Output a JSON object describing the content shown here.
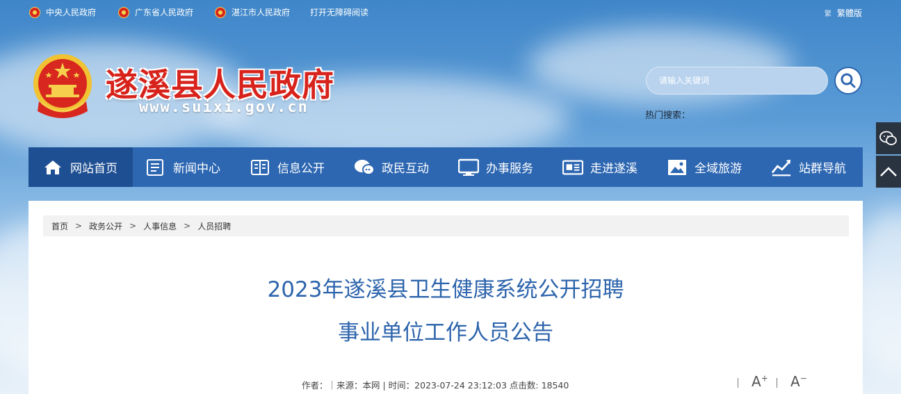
{
  "topbar": {
    "links": [
      {
        "label": "中央人民政府",
        "icon": "emblem-icon"
      },
      {
        "label": "广东省人民政府",
        "icon": "emblem-icon"
      },
      {
        "label": "湛江市人民政府",
        "icon": "emblem-icon"
      }
    ],
    "accessibility": "打开无障碍阅读",
    "traditional": "繁體版",
    "traditional_icon": "繁"
  },
  "header": {
    "site_name": "遂溪县人民政府",
    "site_url": "www.suixi.gov.cn",
    "search_placeholder": "请输入关键词",
    "hot_search_label": "热门搜索："
  },
  "nav": [
    {
      "label": "网站首页",
      "icon": "home-icon",
      "active": true
    },
    {
      "label": "新闻中心",
      "icon": "news-icon"
    },
    {
      "label": "信息公开",
      "icon": "book-icon"
    },
    {
      "label": "政民互动",
      "icon": "chat-icon"
    },
    {
      "label": "办事服务",
      "icon": "monitor-icon"
    },
    {
      "label": "走进遂溪",
      "icon": "newspaper-icon"
    },
    {
      "label": "全域旅游",
      "icon": "picture-icon"
    },
    {
      "label": "站群导航",
      "icon": "chart-icon"
    }
  ],
  "side": {
    "wechat_icon": "wechat-icon",
    "top_icon": "chevron-up-icon"
  },
  "breadcrumb": [
    "首页",
    "政务公开",
    "人事信息",
    "人员招聘"
  ],
  "breadcrumb_sep": ">",
  "article": {
    "title_line1": "2023年遂溪县卫生健康系统公开招聘",
    "title_line2": "事业单位工作人员公告",
    "meta": "作者：｜来源：本网 | 时间：2023-07-24 23:12:03 点击数: 18540",
    "font_increase": "A",
    "font_increase_sign": "+",
    "font_decrease": "A",
    "font_decrease_sign": "−"
  },
  "colors": {
    "nav": "#2d67b2",
    "title": "#2d64ac",
    "site_name": "#d7231b"
  }
}
